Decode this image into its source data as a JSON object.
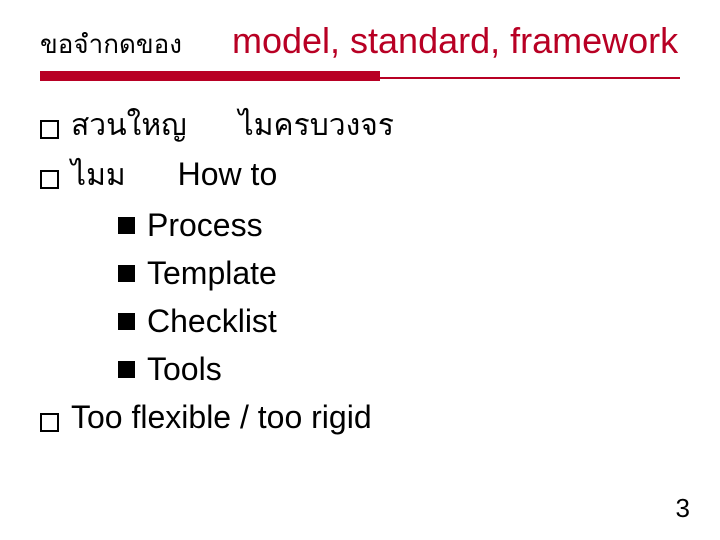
{
  "title": {
    "thai_prefix": "ขอจำกดของ",
    "latin_part": "model, standard, framework"
  },
  "bullets": {
    "b1_thai_a": "สวนใหญ",
    "b1_thai_b": "ไมครบวงจร",
    "b2_thai": "ไมม",
    "b2_latin": "How to",
    "sub": [
      "Process",
      "Template",
      "Checklist",
      "Tools"
    ],
    "b3": "Too flexible / too rigid"
  },
  "page_number": "3",
  "colors": {
    "accent": "#b80024"
  }
}
